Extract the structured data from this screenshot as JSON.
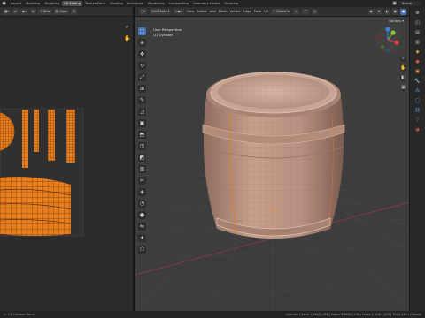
{
  "workspace_tabs": [
    "Layout",
    "Modeling",
    "Sculpting",
    "UV Editing",
    "Texture Paint",
    "Shading",
    "Animation",
    "Rendering",
    "Compositing",
    "Geometry Nodes",
    "Scripting"
  ],
  "active_workspace": "UV Editing",
  "scene_name": "Scene",
  "uv_editor": {
    "header_items": [
      "View",
      "Select",
      "Image",
      "UVs"
    ],
    "new_label": "New",
    "open_label": "Open",
    "tool_icons": [
      "zoom-icon",
      "hand-icon"
    ]
  },
  "viewport": {
    "mode": "Edit Mode",
    "menus": [
      "View",
      "Select",
      "Add",
      "Mesh",
      "Vertex",
      "Edge",
      "Face",
      "UV"
    ],
    "transform_orientation": "Global",
    "options_label": "Options",
    "overlay_line1": "User Perspective",
    "overlay_line2": "(1) Cylinder",
    "tools": [
      "select-box-icon",
      "cursor-icon",
      "move-icon",
      "rotate-icon",
      "scale-icon",
      "transform-icon",
      "annotate-icon",
      "measure-icon",
      "add-cube-icon",
      "extrude-icon",
      "inset-icon",
      "bevel-icon",
      "loop-cut-icon",
      "knife-icon",
      "poly-build-icon",
      "spin-icon",
      "smooth-icon",
      "edge-slide-icon",
      "shrink-icon",
      "shear-icon",
      "rip-icon"
    ],
    "gizmo": {
      "x_color": "#e83b4e",
      "y_color": "#8ac53a",
      "z_color": "#3e7de0"
    }
  },
  "status_bar": {
    "left_text": "UV Context Menu",
    "stats": "Cylinder | Verts 1,184/1,184 | Edges 2,208/2,208 | Faces 1,024/1,024 | Tris 2,168 | Objects"
  },
  "colors": {
    "accent": "#4772b3",
    "uv_island": "#e87e1e",
    "mesh_face": "#c9a08c"
  }
}
